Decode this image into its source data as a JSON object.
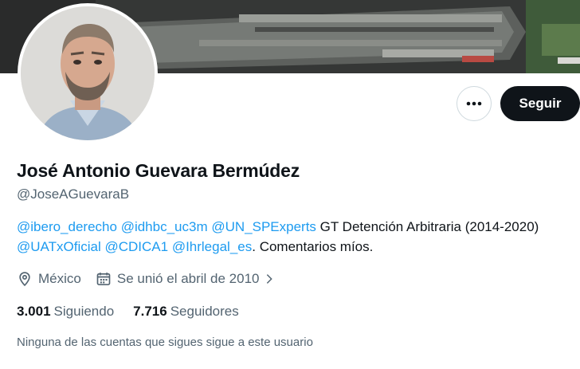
{
  "profile": {
    "display_name": "José Antonio Guevara Bermúdez",
    "handle": "@JoseAGuevaraB",
    "bio": {
      "mention_1": "@ibero_derecho",
      "mention_2": "@idhbc_uc3m",
      "mention_3": "@UN_SPExperts",
      "text_1": " GT Detención Arbitraria (2014-2020) ",
      "mention_4": "@UATxOficial",
      "mention_5": "@CDICA1",
      "mention_6": "@Ihrlegal_es",
      "text_2": ". Comentarios míos."
    },
    "location": "México",
    "joined": "Se unió el abril de 2010",
    "following_count": "3.001",
    "following_label": "Siguiendo",
    "followers_count": "7.716",
    "followers_label": "Seguidores",
    "mutual_note": "Ninguna de las cuentas que sigues sigue a este usuario"
  },
  "actions": {
    "follow_label": "Seguir",
    "more_icon": "more-horizontal-icon"
  },
  "colors": {
    "link": "#1d9bf0",
    "secondary_text": "#536471",
    "primary_text": "#0f1419",
    "follow_button_bg": "#0f1419"
  }
}
